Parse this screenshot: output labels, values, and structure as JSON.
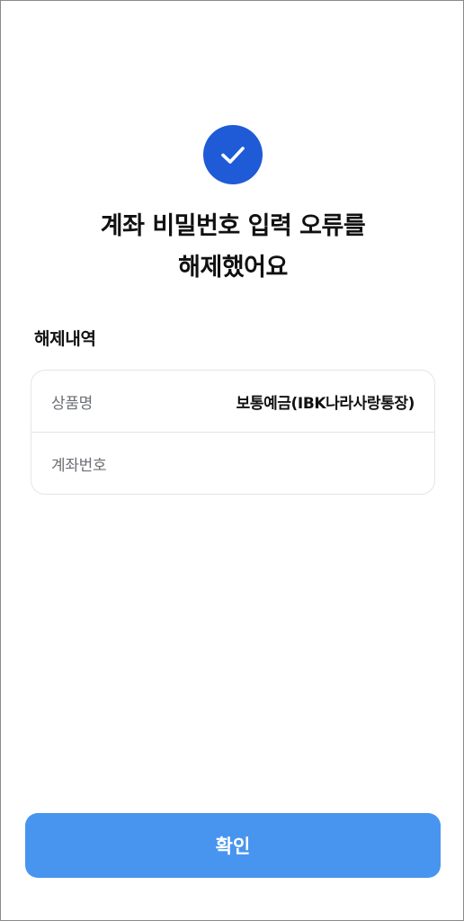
{
  "result": {
    "icon": "check-icon",
    "accent_color": "#1f5bd6",
    "title_line1": "계좌 비밀번호 입력 오류를",
    "title_line2": "해제했어요"
  },
  "details": {
    "section_label": "해제내역",
    "rows": [
      {
        "label": "상품명",
        "value": "보통예금(IBK나라사랑통장)"
      },
      {
        "label": "계좌번호",
        "value": ""
      }
    ]
  },
  "footer": {
    "confirm_label": "확인",
    "button_color": "#4895ef"
  }
}
